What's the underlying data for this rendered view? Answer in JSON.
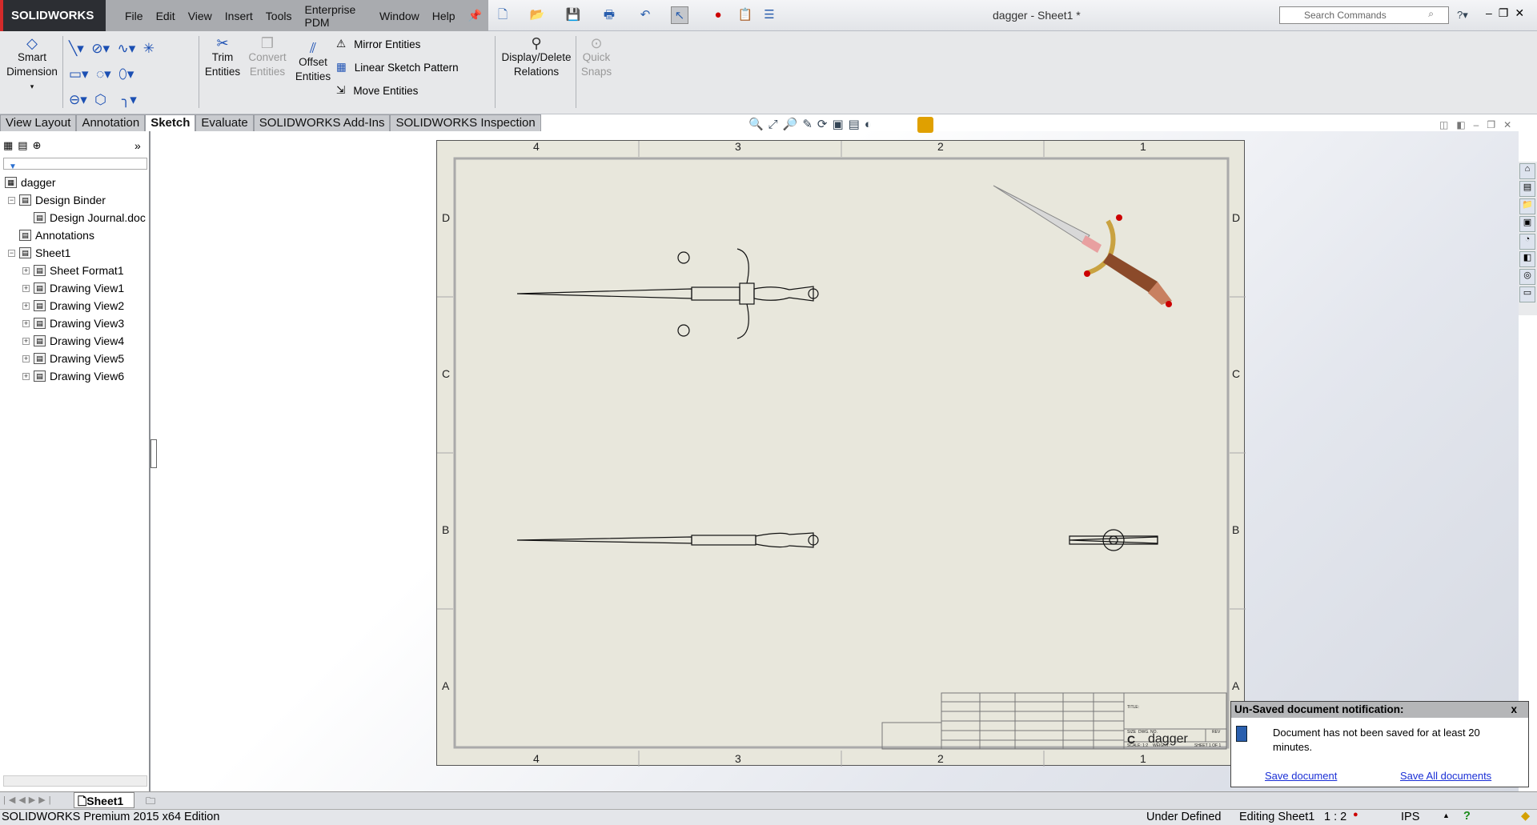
{
  "app": {
    "logo": "SOLIDWORKS",
    "document_title": "dagger - Sheet1 *"
  },
  "menu": [
    "File",
    "Edit",
    "View",
    "Insert",
    "Tools",
    "Enterprise PDM",
    "Window",
    "Help"
  ],
  "search": {
    "placeholder": "Search Commands"
  },
  "ribbon": {
    "smart_dimension": [
      "Smart",
      "Dimension"
    ],
    "trim": [
      "Trim",
      "Entities"
    ],
    "convert": [
      "Convert",
      "Entities"
    ],
    "offset": [
      "Offset",
      "Entities"
    ],
    "mirror": "Mirror Entities",
    "linear_pattern": "Linear Sketch Pattern",
    "move": "Move Entities",
    "relations": [
      "Display/Delete",
      "Relations"
    ],
    "quick_snaps": [
      "Quick",
      "Snaps"
    ]
  },
  "tabs": [
    "View Layout",
    "Annotation",
    "Sketch",
    "Evaluate",
    "SOLIDWORKS Add-Ins",
    "SOLIDWORKS Inspection"
  ],
  "active_tab": "Sketch",
  "tree": {
    "root": "dagger",
    "items": [
      {
        "label": "Design Binder",
        "level": 1
      },
      {
        "label": "Design Journal.doc",
        "level": 2
      },
      {
        "label": "Annotations",
        "level": 1
      },
      {
        "label": "Sheet1",
        "level": 1
      },
      {
        "label": "Sheet Format1",
        "level": 2
      },
      {
        "label": "Drawing View1",
        "level": 2
      },
      {
        "label": "Drawing View2",
        "level": 2
      },
      {
        "label": "Drawing View3",
        "level": 2
      },
      {
        "label": "Drawing View4",
        "level": 2
      },
      {
        "label": "Drawing View5",
        "level": 2
      },
      {
        "label": "Drawing View6",
        "level": 2
      }
    ]
  },
  "sheet": {
    "cols": [
      "4",
      "3",
      "2",
      "1"
    ],
    "rows": [
      "D",
      "C",
      "B",
      "A"
    ],
    "title_block": {
      "size": "C",
      "dwg_no": "dagger",
      "labels": [
        "SIZE",
        "DWG. NO.",
        "REV",
        "SCALE: 1:2",
        "WEIGHT:",
        "SHEET 1 OF 1",
        "TITLE:"
      ]
    }
  },
  "sheet_tabs": [
    "Sheet1"
  ],
  "notification": {
    "title": "Un-Saved document notification:",
    "close": "x",
    "message": "Document has not been saved for at least 20 minutes.",
    "save": "Save document",
    "save_all": "Save All documents"
  },
  "status": {
    "edition": "SOLIDWORKS Premium 2015 x64 Edition",
    "state": "Under Defined",
    "editing": "Editing Sheet1",
    "scale": "1 : 2",
    "units": "IPS"
  }
}
